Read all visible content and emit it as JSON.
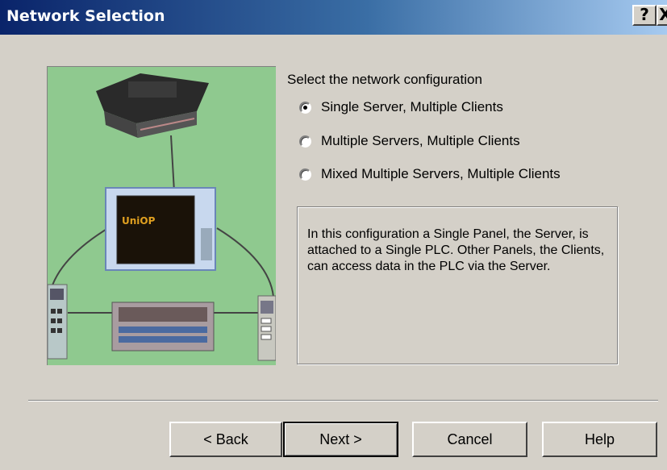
{
  "window": {
    "title": "Network Selection",
    "help_button": "?",
    "close_button": "X"
  },
  "prompt": "Select the network configuration",
  "options": [
    {
      "label": "Single Server, Multiple Clients",
      "selected": true
    },
    {
      "label": "Multiple Servers, Multiple Clients",
      "selected": false
    },
    {
      "label": "Mixed Multiple Servers, Multiple Clients",
      "selected": false
    }
  ],
  "description": "In this configuration a Single Panel, the Server, is attached to a Single PLC. Other Panels, the Clients, can access data in the PLC via the Server.",
  "illustration": {
    "screen_text": "UniOP"
  },
  "buttons": {
    "back": "< Back",
    "next": "Next >",
    "cancel": "Cancel",
    "help": "Help"
  },
  "colors": {
    "title_gradient_start": "#0a246a",
    "title_gradient_end": "#a6caf0",
    "dialog_bg": "#d4d0c8",
    "illustration_bg": "#8fc98f"
  }
}
